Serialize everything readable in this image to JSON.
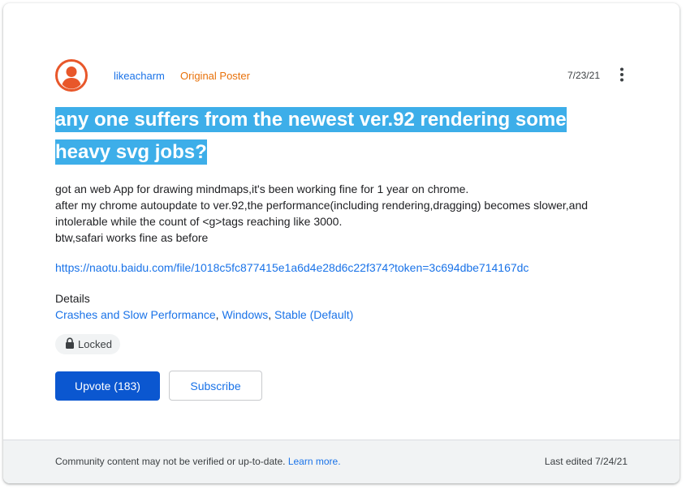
{
  "post": {
    "author": "likeacharm",
    "author_badge": "Original Poster",
    "date": "7/23/21",
    "title": "any one suffers from the newest ver.92 rendering some heavy svg jobs?",
    "body_lines": [
      "got an web App for drawing mindmaps,it's been working fine for 1 year on chrome.",
      "after my chrome autoupdate to ver.92,the performance(including rendering,dragging) becomes slower,and intolerable while the count of <g>tags reaching like 3000.",
      "btw,safari works fine as before"
    ],
    "link": "https://naotu.baidu.com/file/1018c5fc877415e1a6d4e28d6c22f374?token=3c694dbe714167dc"
  },
  "details": {
    "label": "Details",
    "tags": [
      "Crashes and Slow Performance",
      "Windows",
      "Stable (Default)"
    ],
    "separator": ", "
  },
  "status": {
    "locked_label": "Locked"
  },
  "actions": {
    "upvote_label": "Upvote (183)",
    "subscribe_label": "Subscribe"
  },
  "footer": {
    "note": "Community content may not be verified or up-to-date.",
    "learn_more": "Learn more.",
    "last_edited": "Last edited 7/24/21"
  },
  "icons": {
    "avatar": "account-circle-icon",
    "more": "more-vert-icon",
    "lock": "lock-icon"
  },
  "colors": {
    "link": "#1a73e8",
    "badge": "#e8710a",
    "avatar": "#e8572a",
    "title_highlight": "#3daee9",
    "upvote_button": "#0b57d0"
  }
}
